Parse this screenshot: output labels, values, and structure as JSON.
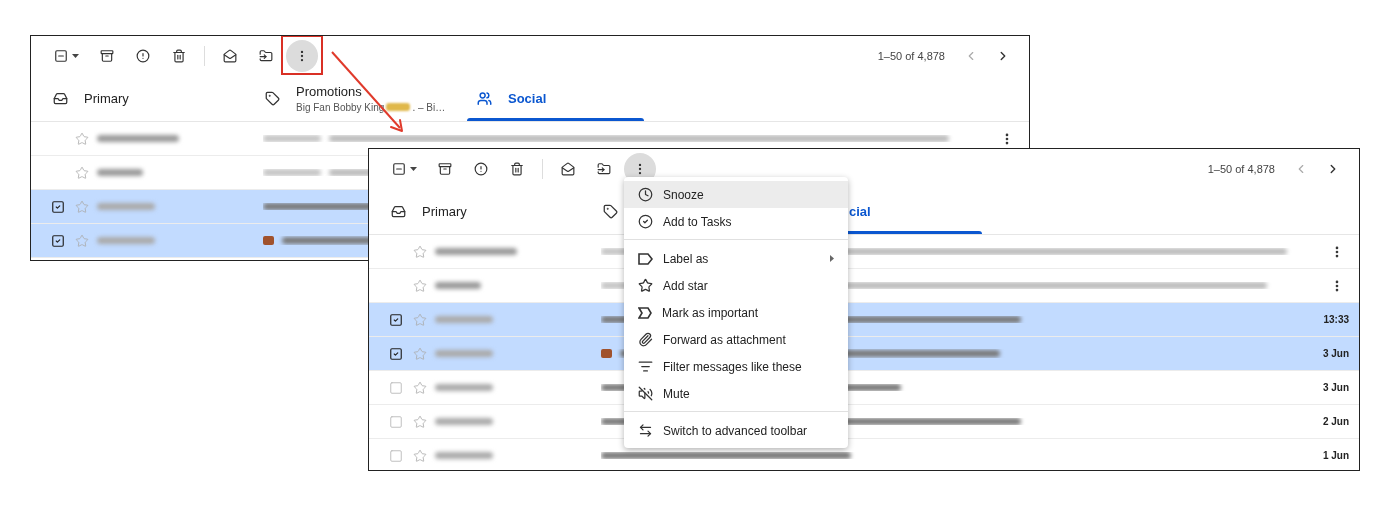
{
  "screenshots": [
    {
      "toolbar": {
        "pager": "1–50 of 4,878",
        "more_active": true,
        "more_highlighted": true
      },
      "tabs": [
        {
          "kind": "primary",
          "label": "Primary",
          "icon": true,
          "selected": false
        },
        {
          "kind": "promotions",
          "label": "Promotions",
          "subtitle_start": "Big Fan Bobby King",
          "subtitle_end": ". – Bi…",
          "icon": true,
          "selected": false
        },
        {
          "kind": "social",
          "label": "Social",
          "icon": true,
          "selected": true
        }
      ],
      "rows": [
        {
          "kind": "sponsored",
          "selected": false,
          "more": true
        },
        {
          "kind": "sponsored",
          "selected": false,
          "more": false
        },
        {
          "kind": "message",
          "checked": true,
          "selected": true,
          "emoji": false
        },
        {
          "kind": "message",
          "checked": true,
          "selected": true,
          "emoji": true
        }
      ]
    },
    {
      "toolbar": {
        "pager": "1–50 of 4,878",
        "more_active": true,
        "more_highlighted": false
      },
      "tabs": [
        {
          "kind": "primary",
          "label": "Primary",
          "icon": true,
          "selected": false
        },
        {
          "kind": "promotions",
          "icon": true,
          "selected": false
        },
        {
          "kind": "social",
          "label": "cial",
          "icon": false,
          "selected": true
        }
      ],
      "rows": [
        {
          "kind": "sponsored",
          "selected": false,
          "more": true
        },
        {
          "kind": "sponsored",
          "selected": false,
          "more": true
        },
        {
          "kind": "message",
          "checked": true,
          "selected": true,
          "emoji": false,
          "time": "13:33"
        },
        {
          "kind": "message",
          "checked": true,
          "selected": true,
          "emoji": true,
          "time": "3 Jun"
        },
        {
          "kind": "message",
          "checked": false,
          "selected": false,
          "emoji": false,
          "time": "3 Jun"
        },
        {
          "kind": "message",
          "checked": false,
          "selected": false,
          "emoji": false,
          "time": "2 Jun"
        },
        {
          "kind": "message",
          "checked": false,
          "selected": false,
          "emoji": false,
          "time": "1 Jun"
        }
      ]
    }
  ],
  "menu": {
    "items": [
      {
        "kind": "snooze",
        "label": "Snooze",
        "highlighted": true,
        "submenu": false,
        "divider_before": false
      },
      {
        "kind": "tasks",
        "label": "Add to Tasks",
        "highlighted": false,
        "submenu": false,
        "divider_before": false
      },
      {
        "kind": "label",
        "label": "Label as",
        "highlighted": false,
        "submenu": true,
        "divider_before": true
      },
      {
        "kind": "star",
        "label": "Add star",
        "highlighted": false,
        "submenu": false,
        "divider_before": false
      },
      {
        "kind": "important",
        "label": "Mark as important",
        "highlighted": false,
        "submenu": false,
        "divider_before": false
      },
      {
        "kind": "forward",
        "label": "Forward as attachment",
        "highlighted": false,
        "submenu": false,
        "divider_before": false
      },
      {
        "kind": "filter",
        "label": "Filter messages like these",
        "highlighted": false,
        "submenu": false,
        "divider_before": false
      },
      {
        "kind": "mute",
        "label": "Mute",
        "highlighted": false,
        "submenu": false,
        "divider_before": false
      },
      {
        "kind": "toolbar",
        "label": "Switch to advanced toolbar",
        "highlighted": false,
        "submenu": false,
        "divider_before": true
      }
    ]
  }
}
